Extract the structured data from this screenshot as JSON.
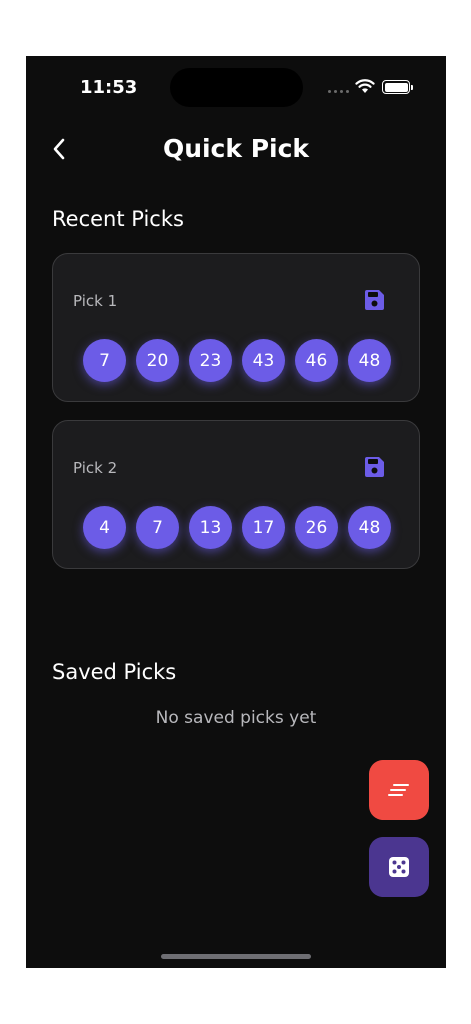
{
  "status_bar": {
    "time": "11:53"
  },
  "header": {
    "title": "Quick Pick"
  },
  "recent": {
    "title": "Recent Picks",
    "picks": [
      {
        "label": "Pick 1",
        "numbers": [
          "7",
          "20",
          "23",
          "43",
          "46",
          "48"
        ]
      },
      {
        "label": "Pick 2",
        "numbers": [
          "4",
          "7",
          "13",
          "17",
          "26",
          "48"
        ]
      }
    ]
  },
  "saved": {
    "title": "Saved Picks",
    "empty_text": "No saved picks yet"
  },
  "icons": {
    "back": "chevron-left-icon",
    "save": "floppy-disk-icon",
    "clear": "clear-list-icon",
    "random": "dice-icon",
    "wifi": "wifi-icon",
    "battery": "battery-icon"
  },
  "colors": {
    "background": "#0d0d0d",
    "card": "#1c1c1e",
    "ball": "#6c5ce7",
    "clear_fab": "#f04a42",
    "random_fab": "#4b3690"
  }
}
